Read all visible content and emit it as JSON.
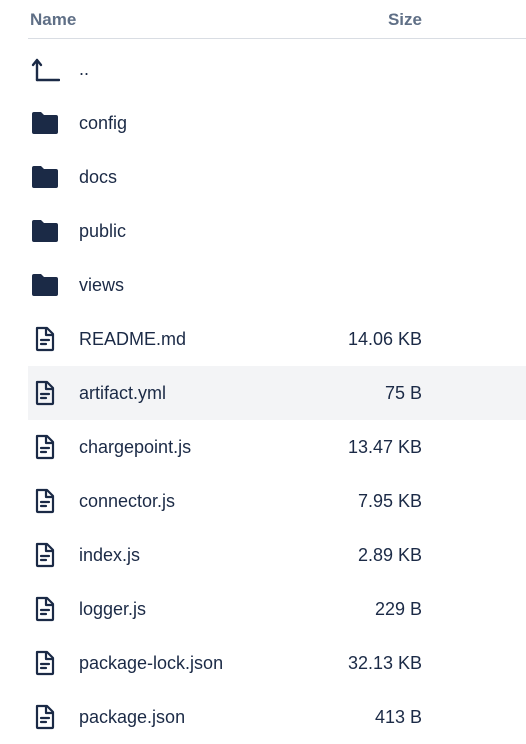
{
  "header": {
    "name_label": "Name",
    "size_label": "Size"
  },
  "rows": [
    {
      "name": "..",
      "size": "",
      "icon": "parent-directory-icon",
      "type": "parent"
    },
    {
      "name": "config",
      "size": "",
      "icon": "folder-icon",
      "type": "folder"
    },
    {
      "name": "docs",
      "size": "",
      "icon": "folder-icon",
      "type": "folder"
    },
    {
      "name": "public",
      "size": "",
      "icon": "folder-icon",
      "type": "folder"
    },
    {
      "name": "views",
      "size": "",
      "icon": "folder-icon",
      "type": "folder"
    },
    {
      "name": "README.md",
      "size": "14.06 KB",
      "icon": "file-icon",
      "type": "file"
    },
    {
      "name": "artifact.yml",
      "size": "75 B",
      "icon": "file-icon",
      "type": "file",
      "highlighted": true
    },
    {
      "name": "chargepoint.js",
      "size": "13.47 KB",
      "icon": "file-icon",
      "type": "file"
    },
    {
      "name": "connector.js",
      "size": "7.95 KB",
      "icon": "file-icon",
      "type": "file"
    },
    {
      "name": "index.js",
      "size": "2.89 KB",
      "icon": "file-icon",
      "type": "file"
    },
    {
      "name": "logger.js",
      "size": "229 B",
      "icon": "file-icon",
      "type": "file"
    },
    {
      "name": "package-lock.json",
      "size": "32.13 KB",
      "icon": "file-icon",
      "type": "file"
    },
    {
      "name": "package.json",
      "size": "413 B",
      "icon": "file-icon",
      "type": "file"
    }
  ],
  "colors": {
    "icon": "#1b2a46",
    "text": "#1b2a46",
    "header_text": "#5f6f86",
    "divider": "#d9dde3",
    "highlight_bg": "#f3f4f6"
  }
}
